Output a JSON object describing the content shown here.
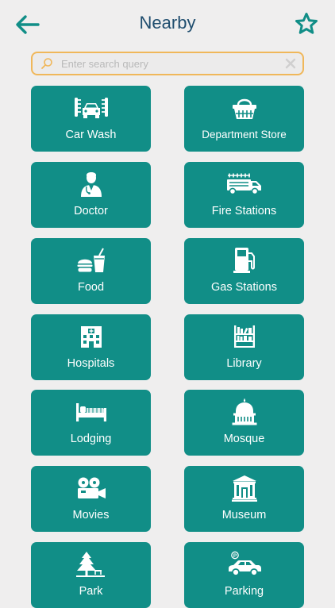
{
  "header": {
    "title": "Nearby"
  },
  "search": {
    "placeholder": "Enter search query",
    "value": ""
  },
  "colors": {
    "accent": "#118e87",
    "title": "#1f4d6e",
    "search_border": "#f0b75a",
    "background": "#efeeee"
  },
  "categories": [
    {
      "label": "Car Wash",
      "icon": "car-wash-icon"
    },
    {
      "label": "Department Store",
      "icon": "shopping-basket-icon"
    },
    {
      "label": "Doctor",
      "icon": "doctor-icon"
    },
    {
      "label": "Fire Stations",
      "icon": "fire-truck-icon"
    },
    {
      "label": "Food",
      "icon": "fast-food-icon"
    },
    {
      "label": "Gas Stations",
      "icon": "gas-pump-icon"
    },
    {
      "label": "Hospitals",
      "icon": "hospital-icon"
    },
    {
      "label": "Library",
      "icon": "bookshelf-icon"
    },
    {
      "label": "Lodging",
      "icon": "bed-icon"
    },
    {
      "label": "Mosque",
      "icon": "mosque-icon"
    },
    {
      "label": "Movies",
      "icon": "movie-camera-icon"
    },
    {
      "label": "Museum",
      "icon": "museum-icon"
    },
    {
      "label": "Park",
      "icon": "tree-icon"
    },
    {
      "label": "Parking",
      "icon": "parking-car-icon"
    }
  ]
}
